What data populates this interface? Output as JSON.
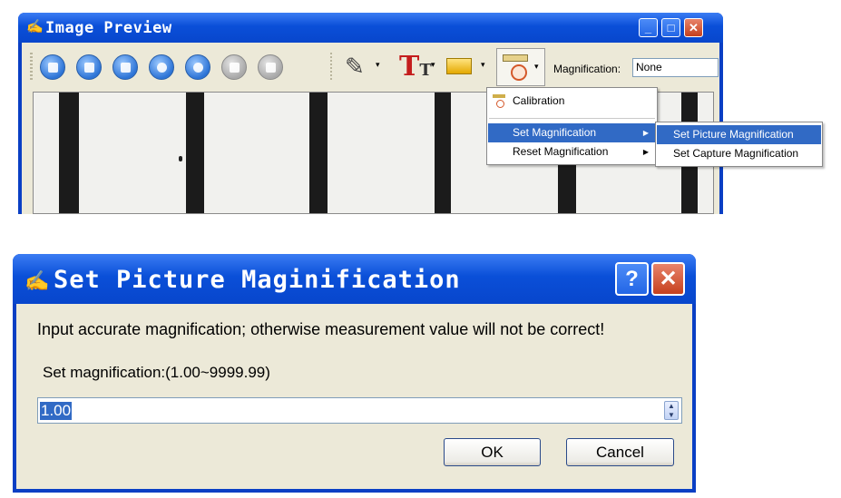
{
  "preview_window": {
    "title": "Image Preview",
    "toolbar": {
      "magnification_label": "Magnification:",
      "magnification_value": "None"
    },
    "menu": {
      "items": [
        "Calibration",
        "Set Magnification",
        "Reset Magnification"
      ]
    },
    "submenu": {
      "items": [
        "Set Picture Magnification",
        "Set Capture Magnification"
      ]
    },
    "text_tool_glyph": "T",
    "text_tool_glyph_small": "T"
  },
  "dialog": {
    "title": "Set Picture Maginification",
    "help_label": "?",
    "message": "Input accurate magnification; otherwise measurement value will not be correct!",
    "range_label": "Set magnification:(1.00~9999.99)",
    "value": "1.00",
    "ok_label": "OK",
    "cancel_label": "Cancel"
  },
  "colors": {
    "title_bar": "#0a4fd8",
    "selection": "#316ac5",
    "client_bg": "#ece9d8",
    "close_button": "#c6401e"
  },
  "icons": {
    "toolbar": [
      "save-icon",
      "open-icon",
      "print-icon",
      "previous-icon",
      "next-icon",
      "undo-icon",
      "redo-icon",
      "pencil-icon",
      "text-icon",
      "label-icon",
      "ruler-icon"
    ],
    "window_buttons": [
      "minimize-icon",
      "maximize-icon",
      "close-icon"
    ]
  }
}
